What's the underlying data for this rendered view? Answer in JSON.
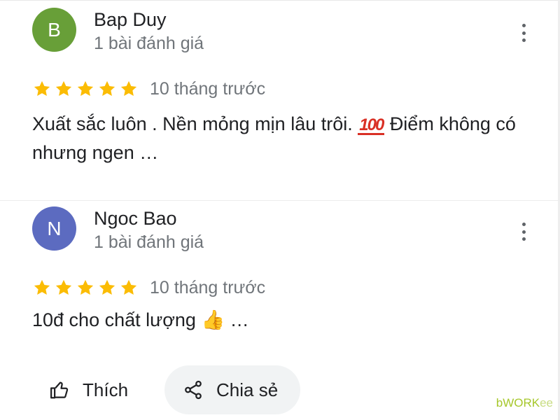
{
  "reviews": [
    {
      "avatar_letter": "B",
      "avatar_color": "#689f38",
      "name": "Bap Duy",
      "review_count": "1 bài đánh giá",
      "rating": 5,
      "time": "10 tháng trước",
      "text_before_emoji": "Xuất sắc luôn . Nền mỏng mịn lâu trôi.",
      "emoji": "💯",
      "text_after_emoji": "Điểm không có nhưng ngen …"
    },
    {
      "avatar_letter": "N",
      "avatar_color": "#5c6bc0",
      "name": "Ngoc Bao",
      "review_count": "1 bài đánh giá",
      "rating": 5,
      "time": "10 tháng trước",
      "text_before_emoji": "10đ cho chất lượng",
      "emoji": "👍",
      "text_after_emoji": "…"
    }
  ],
  "actions": {
    "like_label": "Thích",
    "share_label": "Chia sẻ"
  },
  "watermark": {
    "main": "bWORK",
    "suffix": "ee"
  },
  "colors": {
    "star": "#fbbc04",
    "secondary_text": "#70757a",
    "share_button_bg": "#f1f3f4"
  },
  "icons": [
    "more-vert-icon",
    "star-icon",
    "thumbs-up-icon",
    "share-icon"
  ]
}
